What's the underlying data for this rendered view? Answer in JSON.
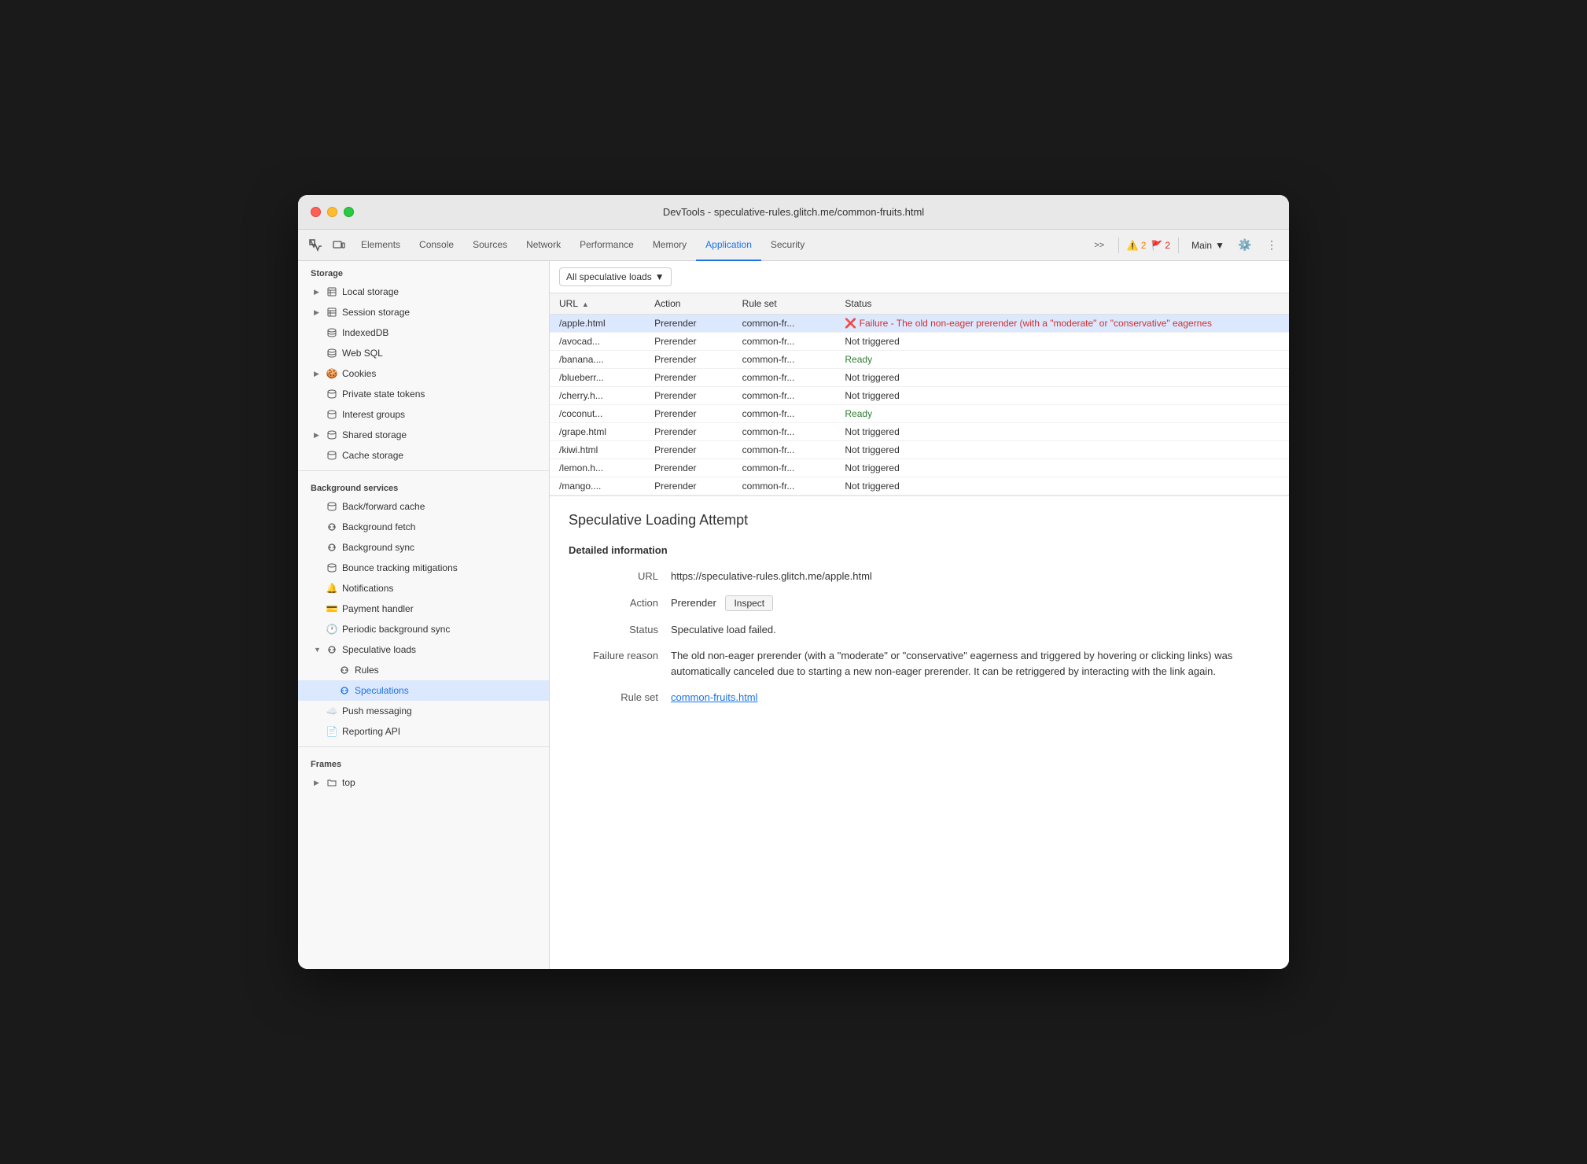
{
  "window": {
    "title": "DevTools - speculative-rules.glitch.me/common-fruits.html"
  },
  "tabs": [
    {
      "id": "elements",
      "label": "Elements",
      "active": false
    },
    {
      "id": "console",
      "label": "Console",
      "active": false
    },
    {
      "id": "sources",
      "label": "Sources",
      "active": false
    },
    {
      "id": "network",
      "label": "Network",
      "active": false
    },
    {
      "id": "performance",
      "label": "Performance",
      "active": false
    },
    {
      "id": "memory",
      "label": "Memory",
      "active": false
    },
    {
      "id": "application",
      "label": "Application",
      "active": true
    },
    {
      "id": "security",
      "label": "Security",
      "active": false
    }
  ],
  "toolbar": {
    "warnings": "2",
    "errors": "2",
    "main_label": "Main",
    "more_tabs": ">>"
  },
  "sidebar": {
    "storage_header": "Storage",
    "items": [
      {
        "id": "local-storage",
        "label": "Local storage",
        "icon": "table",
        "expandable": true,
        "indent": 0
      },
      {
        "id": "session-storage",
        "label": "Session storage",
        "icon": "table",
        "expandable": true,
        "indent": 0
      },
      {
        "id": "indexeddb",
        "label": "IndexedDB",
        "icon": "db",
        "expandable": false,
        "indent": 0
      },
      {
        "id": "web-sql",
        "label": "Web SQL",
        "icon": "db",
        "expandable": false,
        "indent": 0
      },
      {
        "id": "cookies",
        "label": "Cookies",
        "icon": "cookie",
        "expandable": true,
        "indent": 0
      },
      {
        "id": "private-state",
        "label": "Private state tokens",
        "icon": "db",
        "expandable": false,
        "indent": 0
      },
      {
        "id": "interest-groups",
        "label": "Interest groups",
        "icon": "db",
        "expandable": false,
        "indent": 0
      },
      {
        "id": "shared-storage",
        "label": "Shared storage",
        "icon": "db",
        "expandable": true,
        "indent": 0
      },
      {
        "id": "cache-storage",
        "label": "Cache storage",
        "icon": "db",
        "expandable": false,
        "indent": 0
      }
    ],
    "bg_header": "Background services",
    "bg_items": [
      {
        "id": "back-forward",
        "label": "Back/forward cache",
        "icon": "db"
      },
      {
        "id": "bg-fetch",
        "label": "Background fetch",
        "icon": "sync"
      },
      {
        "id": "bg-sync",
        "label": "Background sync",
        "icon": "sync"
      },
      {
        "id": "bounce-tracking",
        "label": "Bounce tracking mitigations",
        "icon": "db"
      },
      {
        "id": "notifications",
        "label": "Notifications",
        "icon": "bell"
      },
      {
        "id": "payment-handler",
        "label": "Payment handler",
        "icon": "payment"
      },
      {
        "id": "periodic-bg-sync",
        "label": "Periodic background sync",
        "icon": "clock"
      },
      {
        "id": "speculative-loads",
        "label": "Speculative loads",
        "icon": "sync",
        "expandable": true,
        "expanded": true
      },
      {
        "id": "rules",
        "label": "Rules",
        "icon": "sync",
        "indent": 1
      },
      {
        "id": "speculations",
        "label": "Speculations",
        "icon": "sync",
        "indent": 1,
        "active": true
      },
      {
        "id": "push-messaging",
        "label": "Push messaging",
        "icon": "cloud"
      },
      {
        "id": "reporting-api",
        "label": "Reporting API",
        "icon": "doc"
      }
    ],
    "frames_header": "Frames",
    "frames_items": [
      {
        "id": "top",
        "label": "top",
        "icon": "folder",
        "expandable": true
      }
    ]
  },
  "content": {
    "filter_label": "All speculative loads",
    "table": {
      "columns": [
        "URL",
        "Action",
        "Rule set",
        "Status"
      ],
      "rows": [
        {
          "url": "/apple.html",
          "action": "Prerender",
          "ruleset": "common-fr...",
          "status": "failure",
          "status_text": "❌ Failure - The old non-eager prerender (with a \"moderate\" or \"conservative\" eagernes",
          "selected": true
        },
        {
          "url": "/avocad...",
          "action": "Prerender",
          "ruleset": "common-fr...",
          "status": "not-triggered",
          "status_text": "Not triggered"
        },
        {
          "url": "/banana....",
          "action": "Prerender",
          "ruleset": "common-fr...",
          "status": "ready",
          "status_text": "Ready"
        },
        {
          "url": "/blueberr...",
          "action": "Prerender",
          "ruleset": "common-fr...",
          "status": "not-triggered",
          "status_text": "Not triggered"
        },
        {
          "url": "/cherry.h...",
          "action": "Prerender",
          "ruleset": "common-fr...",
          "status": "not-triggered",
          "status_text": "Not triggered"
        },
        {
          "url": "/coconut...",
          "action": "Prerender",
          "ruleset": "common-fr...",
          "status": "ready",
          "status_text": "Ready"
        },
        {
          "url": "/grape.html",
          "action": "Prerender",
          "ruleset": "common-fr...",
          "status": "not-triggered",
          "status_text": "Not triggered"
        },
        {
          "url": "/kiwi.html",
          "action": "Prerender",
          "ruleset": "common-fr...",
          "status": "not-triggered",
          "status_text": "Not triggered"
        },
        {
          "url": "/lemon.h...",
          "action": "Prerender",
          "ruleset": "common-fr...",
          "status": "not-triggered",
          "status_text": "Not triggered"
        },
        {
          "url": "/mango....",
          "action": "Prerender",
          "ruleset": "common-fr...",
          "status": "not-triggered",
          "status_text": "Not triggered"
        }
      ]
    },
    "detail": {
      "title": "Speculative Loading Attempt",
      "section_title": "Detailed information",
      "fields": {
        "url_label": "URL",
        "url_value": "https://speculative-rules.glitch.me/apple.html",
        "action_label": "Action",
        "action_value": "Prerender",
        "inspect_label": "Inspect",
        "status_label": "Status",
        "status_value": "Speculative load failed.",
        "failure_label": "Failure reason",
        "failure_value": "The old non-eager prerender (with a \"moderate\" or \"conservative\" eagerness and triggered by hovering or clicking links) was automatically canceled due to starting a new non-eager prerender. It can be retriggered by interacting with the link again.",
        "ruleset_label": "Rule set",
        "ruleset_value": "common-fruits.html",
        "ruleset_link": "common-fruits.html"
      }
    }
  }
}
